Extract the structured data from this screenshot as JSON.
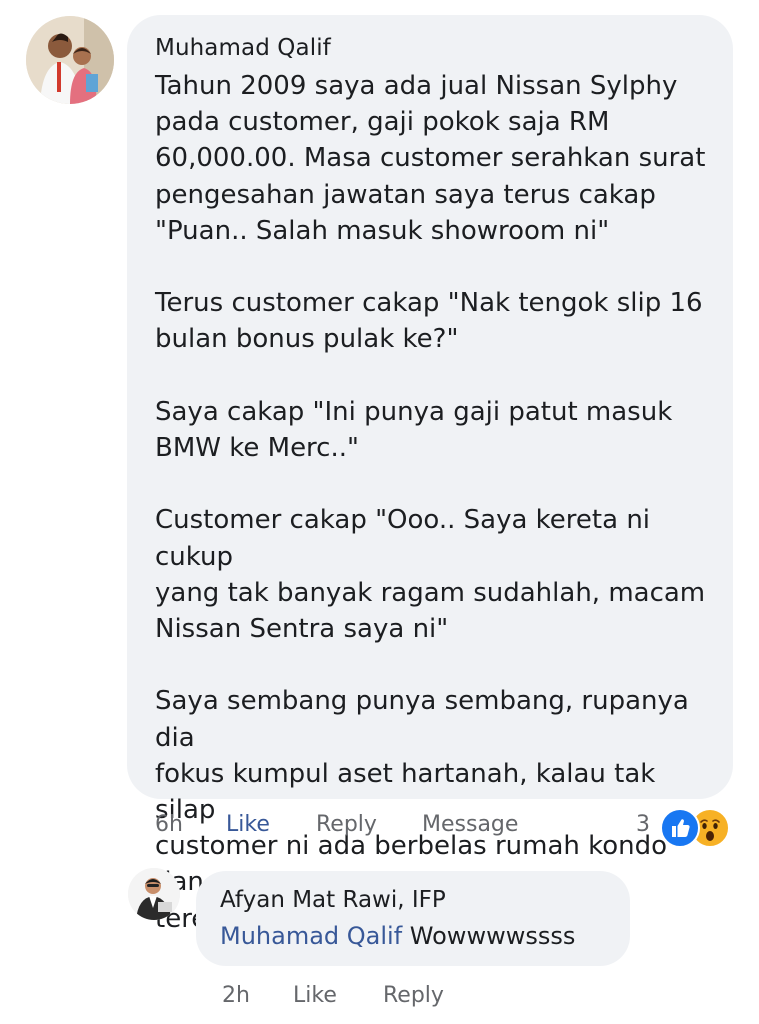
{
  "comment": {
    "author": "Muhamad Qalif",
    "text": "Tahun 2009 saya ada jual Nissan Sylphy\npada customer, gaji pokok saja RM\n60,000.00. Masa customer serahkan surat\npengesahan jawatan saya terus cakap\n\"Puan.. Salah masuk showroom ni\"\n\nTerus customer cakap \"Nak tengok slip 16\nbulan bonus pulak ke?\"\n\nSaya cakap \"Ini punya gaji patut masuk\nBMW ke Merc..\"\n\nCustomer cakap \"Ooo.. Saya kereta ni cukup\nyang tak banyak  ragam sudahlah, macam\nNissan Sentra saya ni\"\n\nSaya sembang punya sembang, rupanya dia\nfokus kumpul aset hartanah, kalau tak silap\ncustomer ni ada berbelas rumah kondo dan\nteres.",
    "time": "6h",
    "like_label": "Like",
    "reply_label": "Reply",
    "message_label": "Message",
    "reaction_count": "3",
    "reactions": [
      "like-icon",
      "wow-icon"
    ]
  },
  "reply": {
    "author": "Afyan Mat Rawi, IFP",
    "mention": "Muhamad Qalif",
    "text": " Wowwwwssss",
    "time": "2h",
    "like_label": "Like",
    "reply_label": "Reply"
  },
  "colors": {
    "bubble": "#f0f2f5",
    "link": "#385898",
    "meta": "#65676b",
    "like_reaction": "#1877f2",
    "wow_reaction": "#f7b125"
  }
}
